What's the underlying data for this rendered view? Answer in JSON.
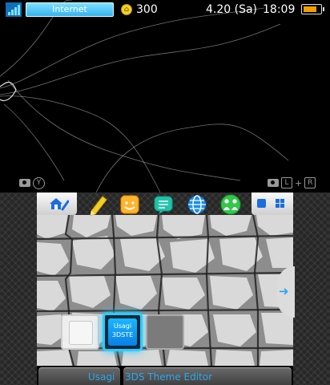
{
  "status_bar": {
    "connection_label": "Internet",
    "coin_count": "300",
    "date": "4.20 (Sa)",
    "time": "18:09",
    "battery_level": 0.8
  },
  "top_hints": {
    "left_button": "Y",
    "right_buttons": [
      "L",
      "+",
      "R"
    ]
  },
  "home_menu": {
    "selected_app": {
      "line1": "Usagi",
      "line2": "3DSTE"
    },
    "bottom_bar": {
      "left_label": "Usagi",
      "right_label": "3DS Theme Editor"
    }
  },
  "colors": {
    "accent": "#2ca7ee",
    "selection_glow": "#2ecbff",
    "battery": "#f2a000"
  }
}
